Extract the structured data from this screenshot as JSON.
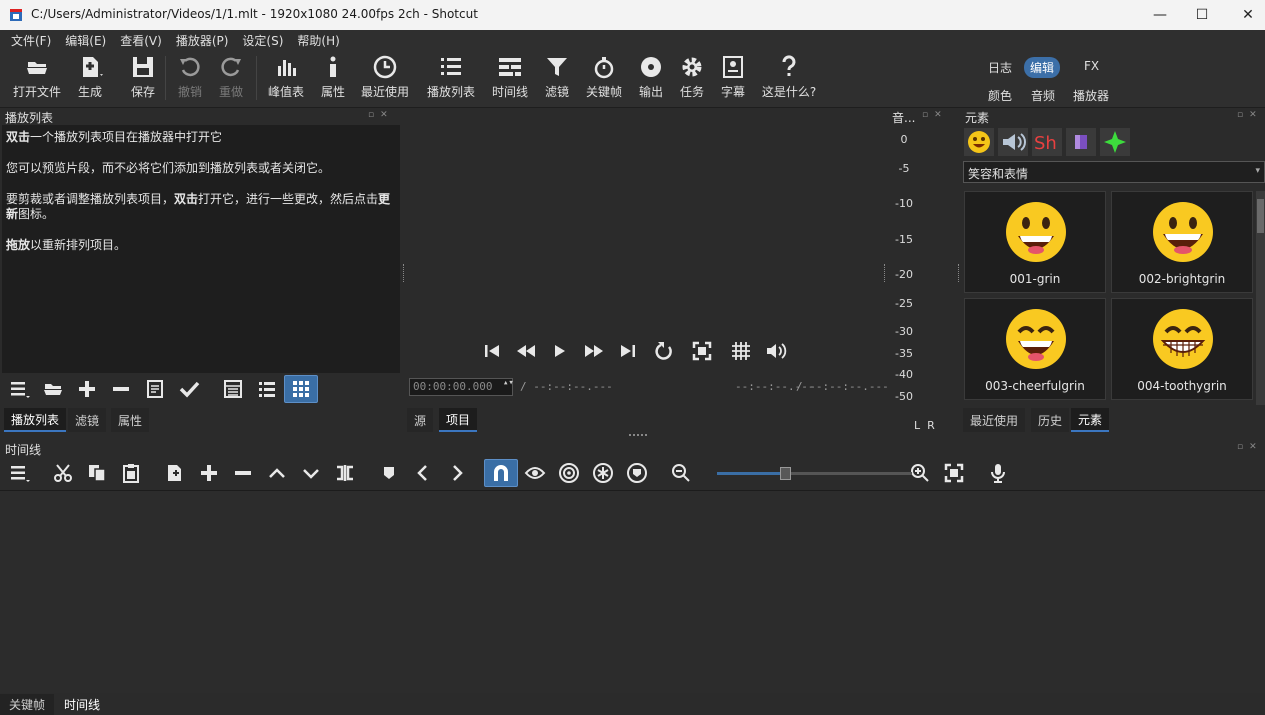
{
  "window": {
    "title": "C:/Users/Administrator/Videos/1/1.mlt - 1920x1080 24.00fps 2ch - Shotcut",
    "minimize": "—",
    "maximize": "☐",
    "close": "✕"
  },
  "menu": [
    "文件(F)",
    "编辑(E)",
    "查看(V)",
    "播放器(P)",
    "设定(S)",
    "帮助(H)"
  ],
  "toolbar": {
    "open": "打开文件",
    "generate": "生成",
    "save": "保存",
    "undo": "撤销",
    "redo": "重做",
    "peak": "峰值表",
    "properties": "属性",
    "recent": "最近使用",
    "playlist": "播放列表",
    "timeline": "时间线",
    "filters": "滤镜",
    "keyframes": "关键帧",
    "export": "输出",
    "jobs": "任务",
    "subtitles": "字幕",
    "whats_this": "这是什么?"
  },
  "layouts": {
    "log": "日志",
    "edit": "编辑",
    "fx": "FX",
    "color": "颜色",
    "audio": "音频",
    "player": "播放器"
  },
  "playlist": {
    "title": "播放列表",
    "line1_bold": "双击",
    "line1_rest": "一个播放列表项目在播放器中打开它",
    "line2": "您可以预览片段，而不必将它们添加到播放列表或者关闭它。",
    "line3_a": "要剪裁或者调整播放列表项目，",
    "line3_bold": "双击",
    "line3_b": "打开它，进行一些更改，然后点击",
    "line3_bold2": "更新",
    "line3_c": "图标。",
    "line4_bold": "拖放",
    "line4_rest": "以重新排列项目。",
    "tabs": [
      "播放列表",
      "滤镜",
      "属性"
    ]
  },
  "player": {
    "timecode": "00:00:00.000",
    "duration": "/ --:--:--.---",
    "in_point": "--:--:--.---",
    "out_point": "/ --:--:--.---",
    "tabs": [
      "源",
      "项目"
    ]
  },
  "meter": {
    "title": "音...",
    "levels": [
      "0",
      "-5",
      "-10",
      "-15",
      "-20",
      "-25",
      "-30",
      "-35",
      "-40",
      "-50"
    ],
    "channels": "L  R"
  },
  "elements": {
    "title": "元素",
    "category": "笑容和表情",
    "items": [
      "001-grin",
      "002-brightgrin",
      "003-cheerfulgrin",
      "004-toothygrin"
    ],
    "tabs": [
      "最近使用",
      "历史",
      "元素"
    ]
  },
  "timeline": {
    "title": "时间线",
    "zoom_level": 0.35
  },
  "bottom_tabs": [
    "关键帧",
    "时间线"
  ]
}
